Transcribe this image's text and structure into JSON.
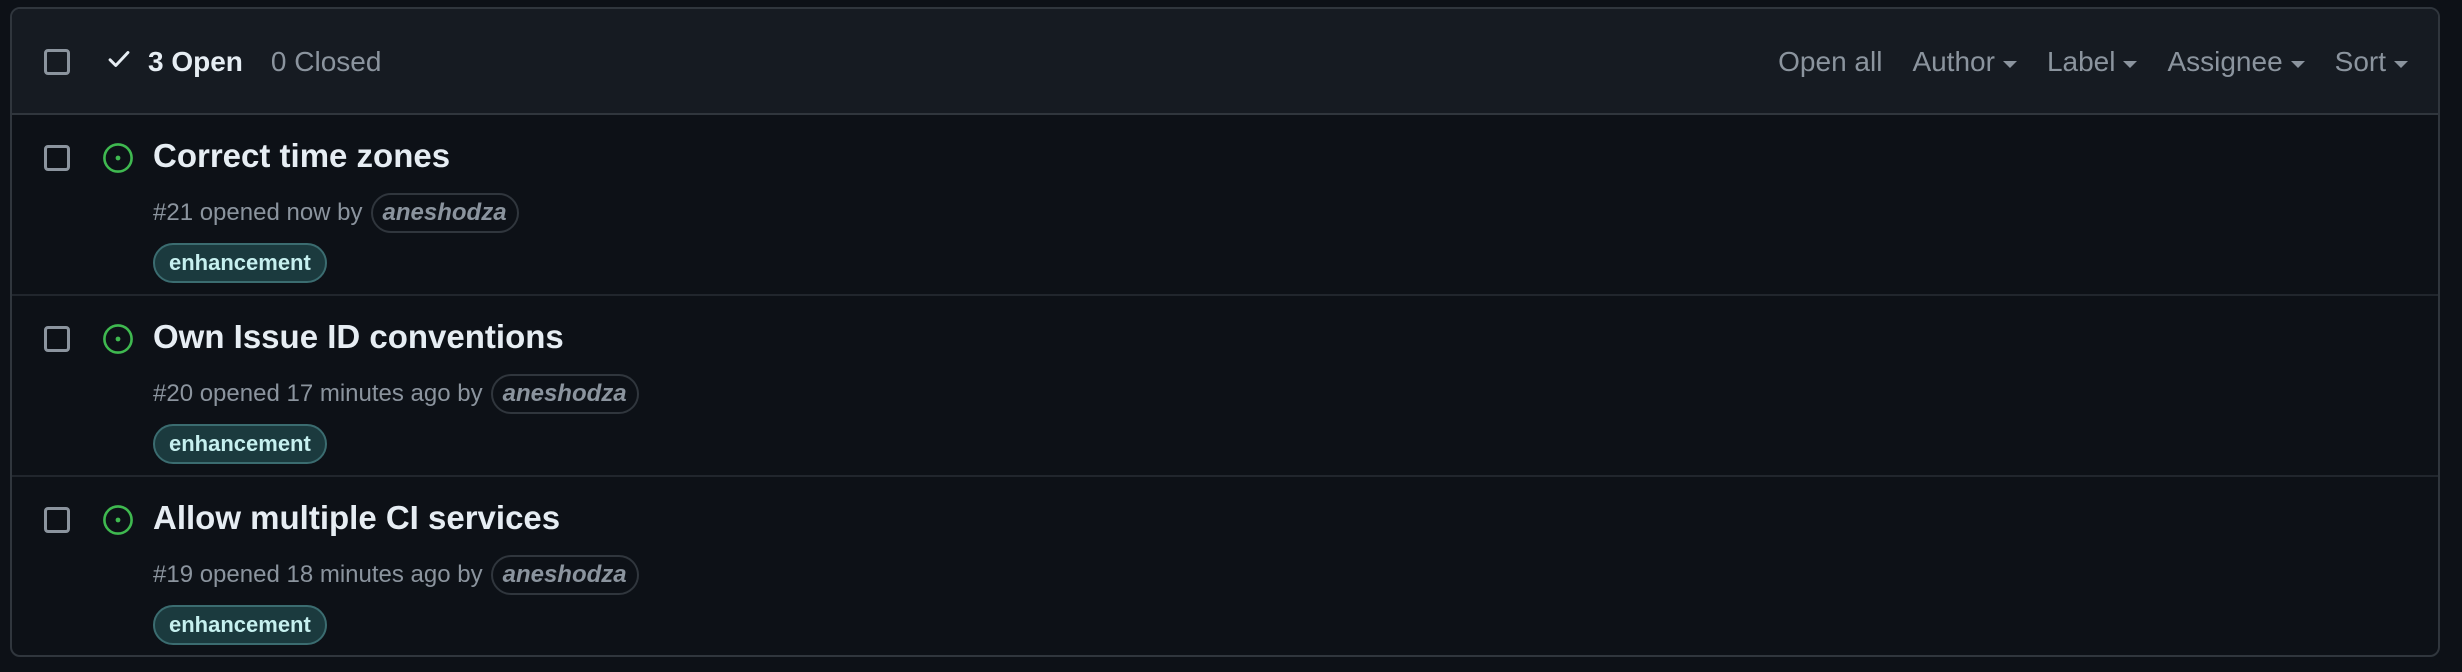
{
  "header": {
    "open_label": "3 Open",
    "closed_label": "0 Closed",
    "filters": [
      "Open all",
      "Author",
      "Label",
      "Assignee",
      "Sort"
    ]
  },
  "issues": [
    {
      "title": "Correct time zones",
      "meta_prefix": "#21 opened now by",
      "author": "aneshodza",
      "label": "enhancement"
    },
    {
      "title": "Own Issue ID conventions",
      "meta_prefix": "#20 opened 17 minutes ago by",
      "author": "aneshodza",
      "label": "enhancement"
    },
    {
      "title": "Allow multiple CI services",
      "meta_prefix": "#19 opened 18 minutes ago by",
      "author": "aneshodza",
      "label": "enhancement"
    }
  ],
  "colors": {
    "background": "#0d1117",
    "header_background": "#161b22",
    "border": "#30363d",
    "open_issue_icon": "#3fb950",
    "label_background": "#1b3a3e",
    "label_text": "#c6f0ef"
  },
  "icons": {
    "open_state": "check-icon",
    "issue_state": "issue-opened-icon",
    "dropdown": "caret-down-icon"
  }
}
